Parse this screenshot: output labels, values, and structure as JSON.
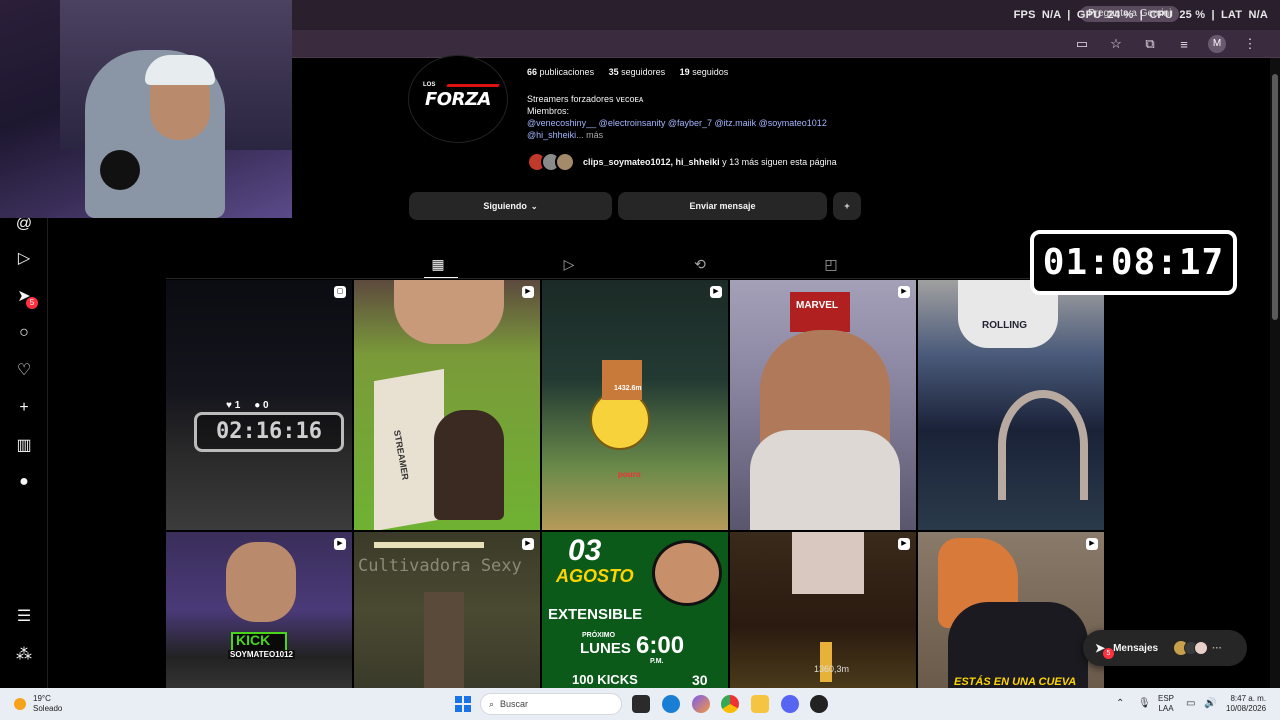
{
  "browser": {
    "perf_overlay": {
      "fps_label": "FPS",
      "fps_value": "N/A",
      "gpu_label": "GPU",
      "gpu_value": "24 %",
      "cpu_label": "CPU",
      "cpu_value": "25 %",
      "lat_label": "LAT",
      "lat_value": "N/A"
    },
    "gemini_chip": "Pregunta a Gemini",
    "profile_avatar_letter": "M"
  },
  "nav": {
    "notifications_badge": "5"
  },
  "profile": {
    "logo_small": "LOS",
    "logo_main": "FORZA",
    "stats": {
      "posts_count": "66",
      "posts_label": "publicaciones",
      "followers_count": "35",
      "followers_label": "seguidores",
      "following_count": "19",
      "following_label": "seguidos"
    },
    "bio": {
      "line1": "Streamers forzadores ᴠᴇᴄᴏᴇᴀ",
      "line2": "Miembros:",
      "mentions_line1": "@venecoshiny__ @electroinsanity @fayber_7 @itz.maiik @soymateo1012",
      "mentions_line2": "@hi_shheiki",
      "more": "... más"
    },
    "followed_by": {
      "names": "clips_soymateo1012, hi_shheiki",
      "rest": " y 13 más siguen esta página"
    },
    "buttons": {
      "following": "Siguiendo",
      "message": "Enviar mensaje"
    }
  },
  "timer_overlay": "01:08:17",
  "posts": [
    {
      "likes": "1",
      "comments": "0",
      "timer": "02:16:16"
    },
    {
      "label": "STREAMER"
    },
    {
      "label": "pouro",
      "distance": "1432.6m"
    },
    {
      "label": "MARVEL"
    },
    {
      "label": "ROLLING"
    },
    {
      "label_top": "KICK",
      "label_bottom": "SOYMATEO1012"
    },
    {
      "label": "Cultivadora Sexy"
    },
    {
      "date_num": "03",
      "date_month": "AGOSTO",
      "brand": "EXTENSIBLE",
      "next": "PRÓXIMO",
      "day": "LUNES",
      "time": "6:00",
      "ampm": "P.M.",
      "kicks_label": "100 KICKS",
      "num": "30"
    },
    {
      "label": "1360,3m"
    },
    {
      "label": "ESTÁS EN UNA CUEVA"
    }
  ],
  "messages": {
    "label": "Mensajes",
    "badge": "5"
  },
  "taskbar": {
    "temp": "19°C",
    "condition": "Soleado",
    "search_placeholder": "Buscar",
    "lang_top": "ESP",
    "lang_bottom": "LAA",
    "time": "8:47 a. m.",
    "date": "10/08/2026"
  },
  "colors": {
    "accent_link": "#a3b6ff",
    "badge_red": "#ff3040",
    "button_bg": "#262626"
  }
}
